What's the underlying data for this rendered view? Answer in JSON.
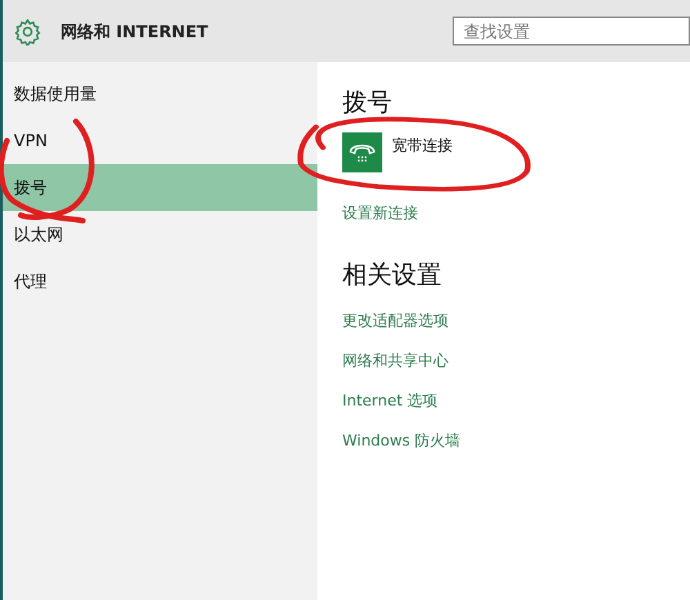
{
  "header": {
    "title": "网络和 INTERNET",
    "search": {
      "placeholder": "查找设置"
    }
  },
  "sidebar": {
    "items": [
      {
        "label": "数据使用量",
        "selected": false
      },
      {
        "label": "VPN",
        "selected": false
      },
      {
        "label": "拨号",
        "selected": true
      },
      {
        "label": "以太网",
        "selected": false
      },
      {
        "label": "代理",
        "selected": false
      }
    ]
  },
  "content": {
    "heading": "拨号",
    "connections": [
      {
        "name": "宽带连接"
      }
    ],
    "setup_link": "设置新连接",
    "related": {
      "heading": "相关设置",
      "links": [
        "更改适配器选项",
        "网络和共享中心",
        "Internet 选项",
        "Windows 防火墙"
      ]
    }
  }
}
